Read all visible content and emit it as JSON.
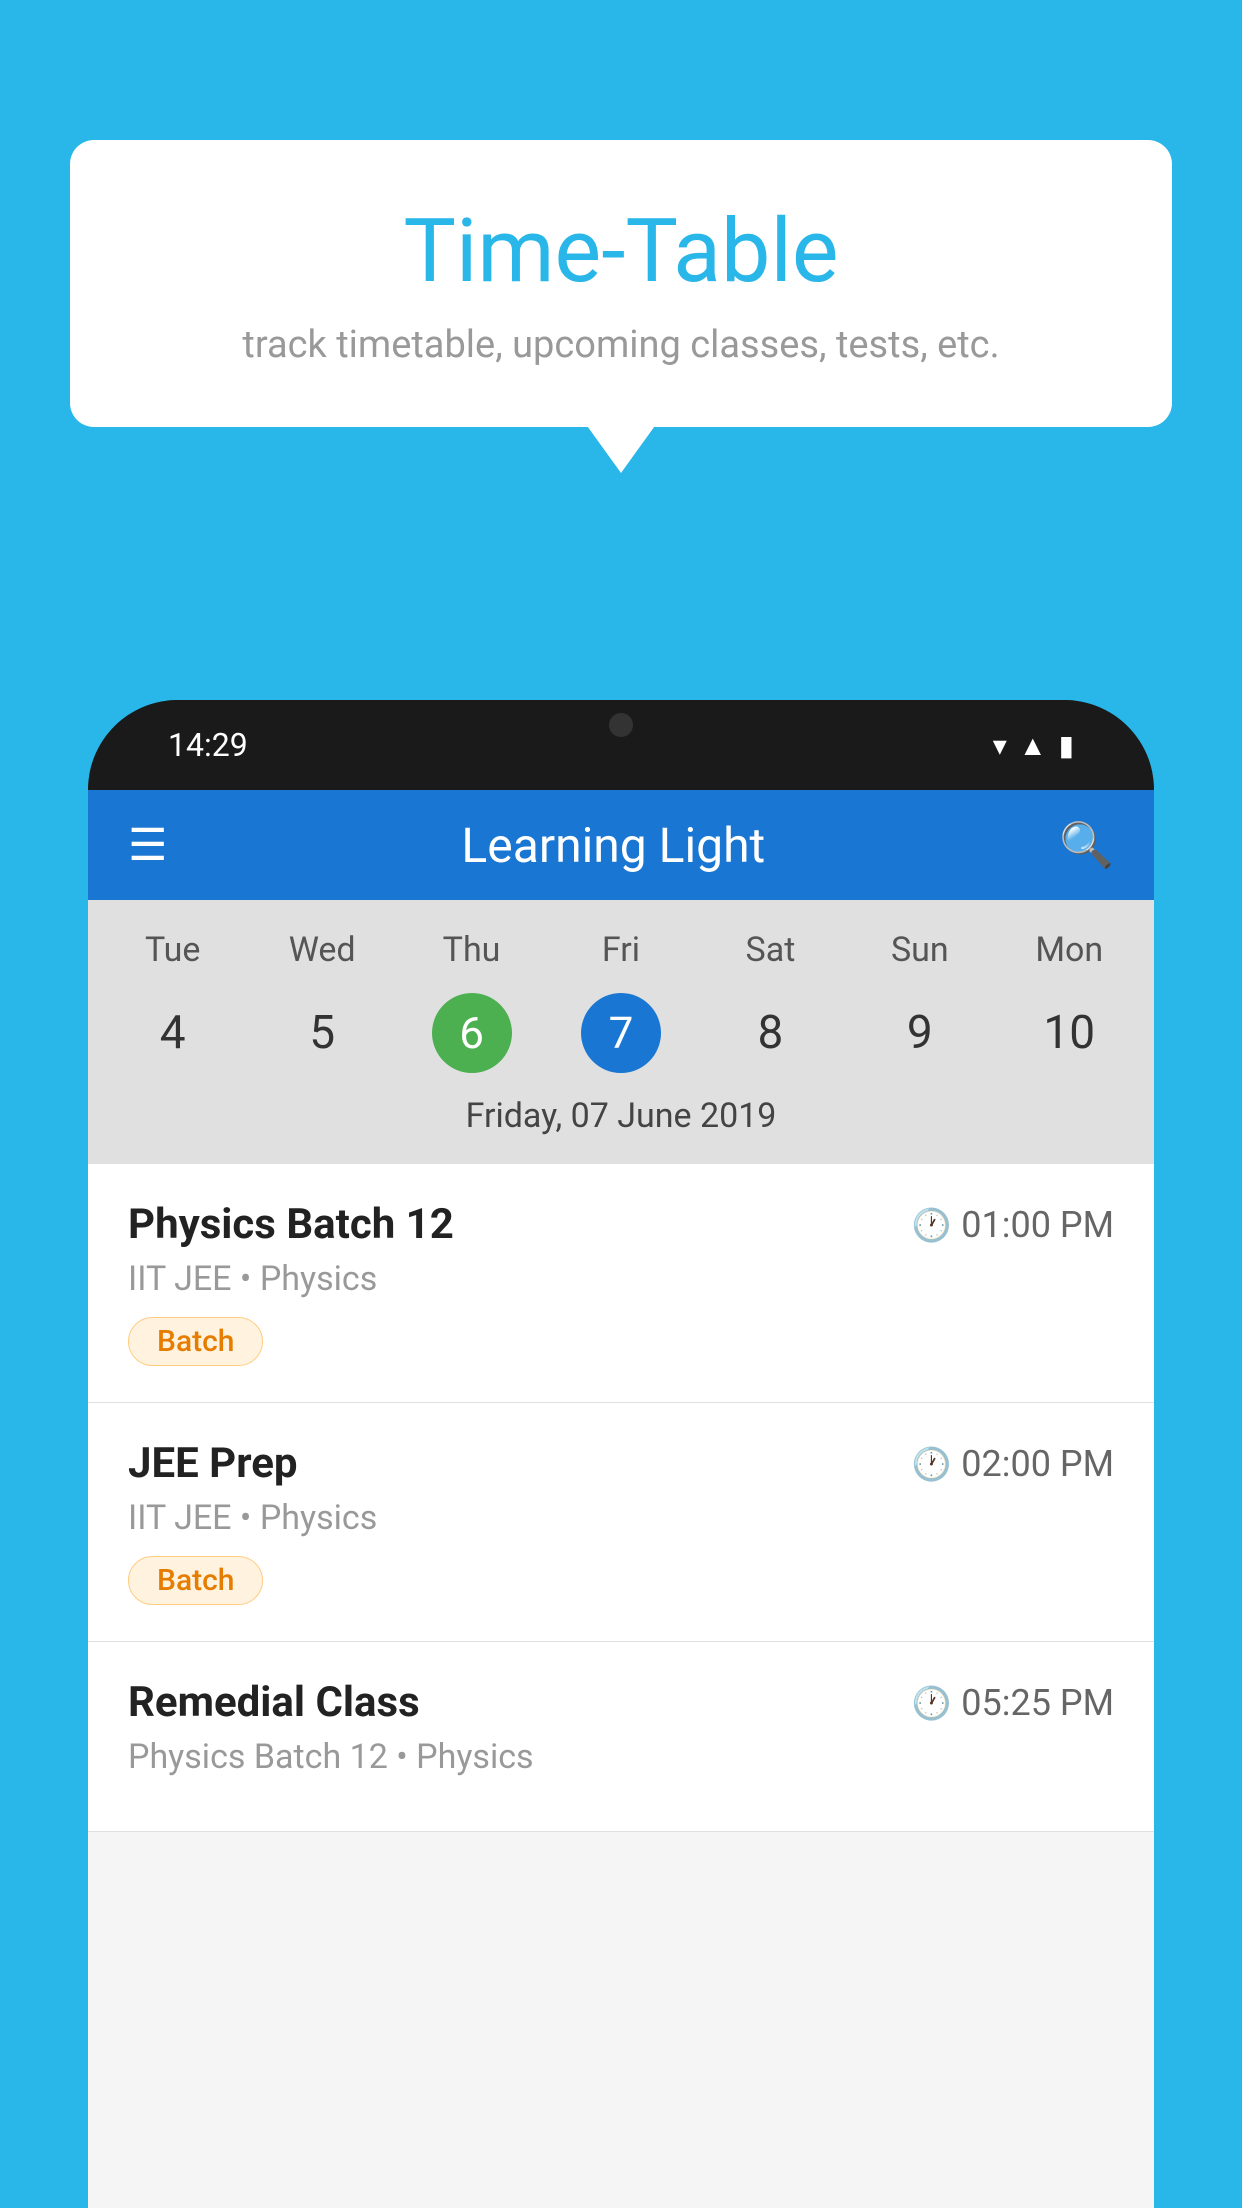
{
  "background_color": "#29b6e8",
  "speech_bubble": {
    "title": "Time-Table",
    "subtitle": "track timetable, upcoming classes, tests, etc."
  },
  "phone": {
    "status_bar": {
      "time": "14:29"
    },
    "app_header": {
      "title": "Learning Light"
    },
    "calendar": {
      "days": [
        "Tue",
        "Wed",
        "Thu",
        "Fri",
        "Sat",
        "Sun",
        "Mon"
      ],
      "dates": [
        "4",
        "5",
        "6",
        "7",
        "8",
        "9",
        "10"
      ],
      "today_index": 2,
      "selected_index": 3,
      "selected_date_label": "Friday, 07 June 2019"
    },
    "classes": [
      {
        "name": "Physics Batch 12",
        "time": "01:00 PM",
        "subtitle": "IIT JEE • Physics",
        "badge": "Batch"
      },
      {
        "name": "JEE Prep",
        "time": "02:00 PM",
        "subtitle": "IIT JEE • Physics",
        "badge": "Batch"
      },
      {
        "name": "Remedial Class",
        "time": "05:25 PM",
        "subtitle": "Physics Batch 12 • Physics",
        "badge": ""
      }
    ]
  }
}
